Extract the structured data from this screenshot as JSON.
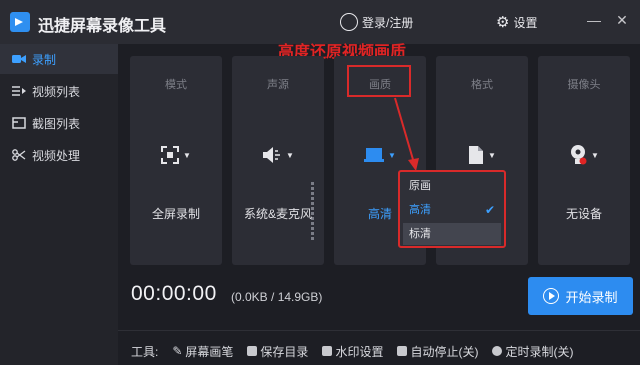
{
  "titlebar": {
    "app_title": "迅捷屏幕录像工具",
    "login_label": "登录/注册",
    "settings_label": "设置",
    "minimize": "—",
    "close": "✕"
  },
  "sidebar": {
    "items": [
      {
        "label": "录制",
        "icon": "video-camera-icon",
        "active": true
      },
      {
        "label": "视频列表",
        "icon": "video-list-icon"
      },
      {
        "label": "截图列表",
        "icon": "screenshot-list-icon"
      },
      {
        "label": "视频处理",
        "icon": "video-edit-icon"
      }
    ]
  },
  "annotation": "高度还原视频画质",
  "cards": [
    {
      "header": "模式",
      "value": "全屏录制",
      "icon": "fullscreen-icon"
    },
    {
      "header": "声源",
      "value": "系统&麦克风",
      "icon": "speaker-icon"
    },
    {
      "header": "画质",
      "value": "高清",
      "icon": "display-icon"
    },
    {
      "header": "格式",
      "value": "",
      "icon": "file-format-icon"
    },
    {
      "header": "摄像头",
      "value": "无设备",
      "icon": "webcam-off-icon"
    }
  ],
  "quality_dropdown": {
    "options": [
      "原画",
      "高清",
      "标清"
    ],
    "selected": "高清"
  },
  "recording": {
    "timer": "00:00:00",
    "size": "(0.0KB / 14.9GB)",
    "start_label": "开始录制"
  },
  "tools": {
    "label": "工具:",
    "items": [
      "屏幕画笔",
      "保存目录",
      "水印设置",
      "自动停止(关)",
      "定时录制(关)"
    ]
  },
  "colors": {
    "accent": "#2d8cf0",
    "annotation": "#d92a2a",
    "background": "#1d1e24"
  }
}
